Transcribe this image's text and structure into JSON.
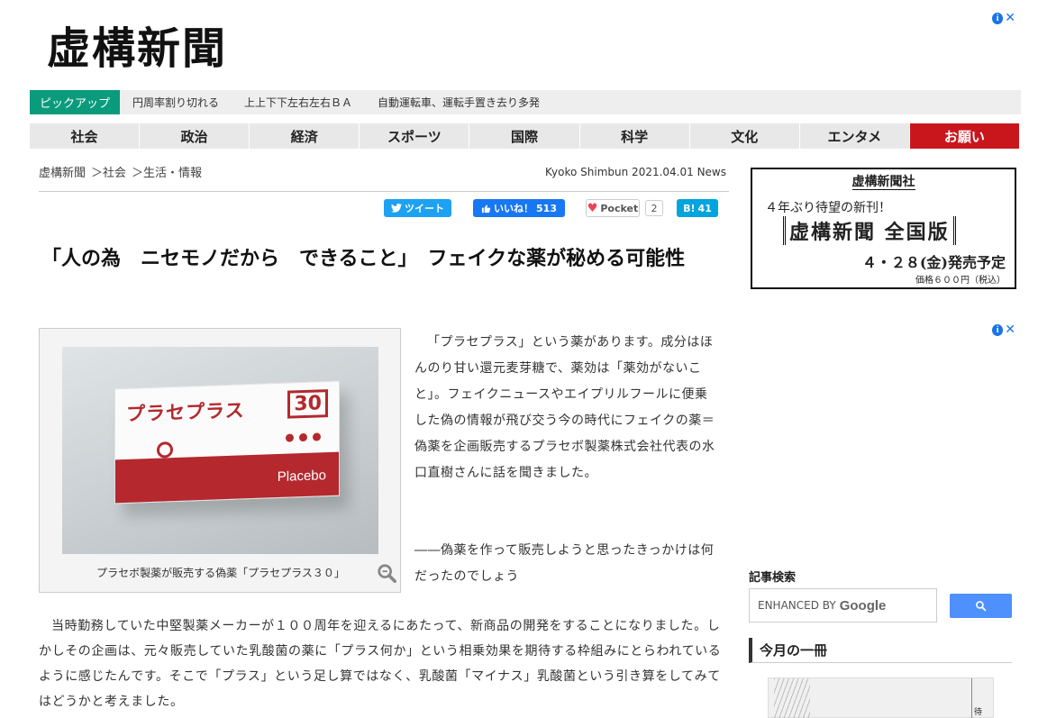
{
  "site": {
    "logo": "虚構新聞"
  },
  "pickup": {
    "label": "ピックアップ",
    "items": [
      "円周率割り切れる",
      "上上下下左右左右ＢＡ",
      "自動運転車、運転手置き去り多発"
    ]
  },
  "nav": {
    "items": [
      "社会",
      "政治",
      "経済",
      "スポーツ",
      "国際",
      "科学",
      "文化",
      "エンタメ",
      "お願い"
    ]
  },
  "breadcrumb": {
    "items": [
      "虚構新聞",
      "＞社会",
      "＞生活・情報"
    ]
  },
  "byline": "Kyoko Shimbun 2021.04.01 News",
  "social": {
    "tweet": "ツイート",
    "like": "いいね！",
    "like_count": "513",
    "pocket": "Pocket",
    "pocket_count": "2",
    "hatena": "B!",
    "hatena_count": "41"
  },
  "article": {
    "headline": "「人の為　ニセモノだから　できること」　フェイクな薬が秘める可能性",
    "image_product": {
      "title": "プラセプラス",
      "number": "30",
      "brand": "Placebo"
    },
    "caption": "プラセボ製薬が販売する偽薬「プラセプラス３０」",
    "lead": "「プラセプラス」という薬があります。成分はほんのり甘い還元麦芽糖で、薬効は「薬効がないこと」。フェイクニュースやエイプリルフールに便乗した偽の情報が飛び交う今の時代にフェイクの薬＝偽薬を企画販売するプラセボ製薬株式会社代表の水口直樹さんに話を聞きました。",
    "question": "――偽薬を作って販売しようと思ったきっかけは何だったのでしょう",
    "answer": "当時勤務していた中堅製薬メーカーが１００周年を迎えるにあたって、新商品の開発をすることになりました。しかしその企画は、元々販売していた乳酸菌の薬に「プラス何か」という相乗効果を期待する枠組みにとらわれているように感じたんです。そこで「プラス」という足し算ではなく、乳酸菌「マイナス」乳酸菌という引き算をしてみてはどうかと考えました。"
  },
  "sidebar": {
    "ad": {
      "publisher": "虚構新聞社",
      "line1": "４年ぶり待望の新刊！",
      "line2": "虚構新聞 全国版",
      "line3": "４・２８(金)発売予定",
      "line4": "価格６００円（税込）"
    },
    "search": {
      "title": "記事検索",
      "placeholder": "ENHANCED BY",
      "brand": "Google"
    },
    "monthly": {
      "title": "今月の一冊",
      "spine": "待"
    }
  },
  "colors": {
    "pickup": "#0a9b7c",
    "request": "#c9161d",
    "twitter": "#1da1f2",
    "facebook": "#1877f2",
    "hatena": "#00a4de",
    "product_red": "#b4282e"
  }
}
